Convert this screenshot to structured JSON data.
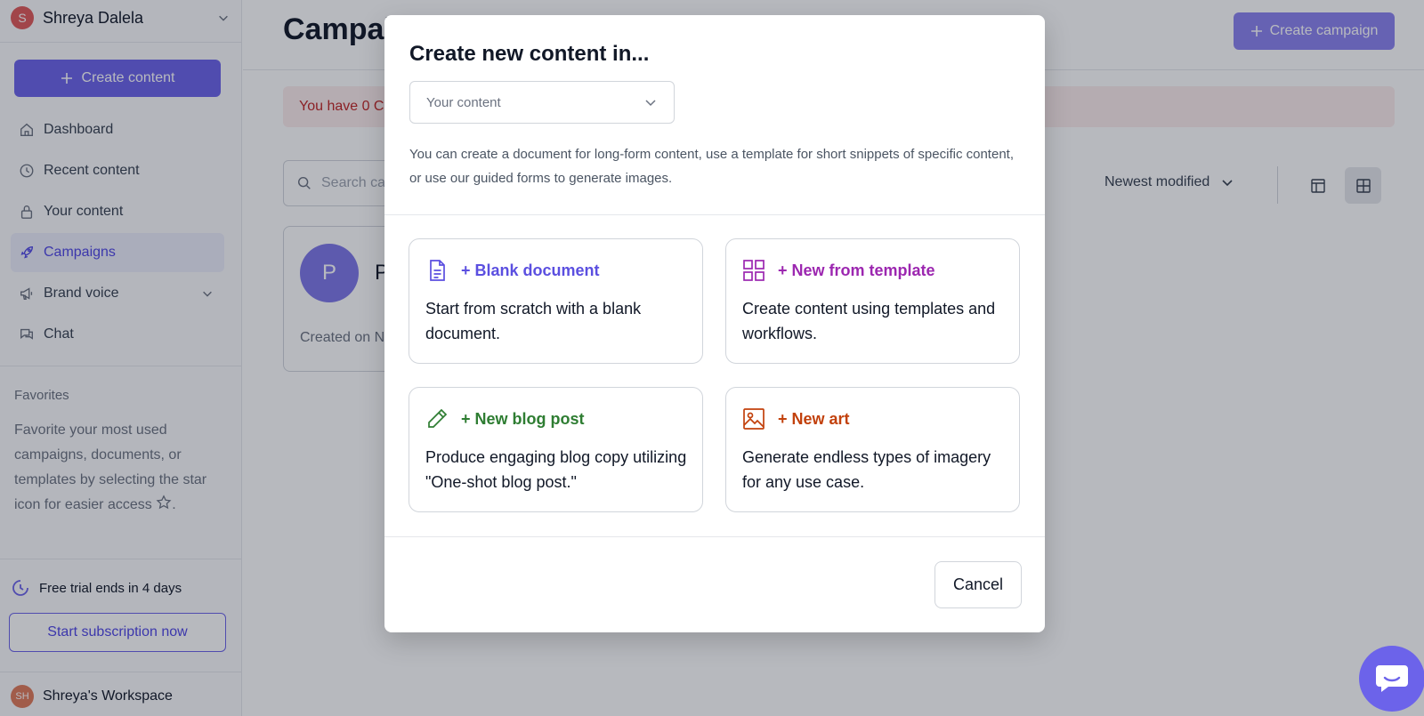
{
  "sidebar": {
    "user": {
      "initial": "S",
      "name": "Shreya Dalela"
    },
    "create_label": "Create content",
    "nav": [
      {
        "label": "Dashboard",
        "icon": "home-icon"
      },
      {
        "label": "Recent content",
        "icon": "clock-icon"
      },
      {
        "label": "Your content",
        "icon": "lock-icon"
      },
      {
        "label": "Campaigns",
        "icon": "rocket-icon",
        "active": true
      },
      {
        "label": "Brand voice",
        "icon": "megaphone-icon",
        "expandable": true
      },
      {
        "label": "Chat",
        "icon": "chat-icon"
      }
    ],
    "favorites": {
      "title": "Favorites",
      "text": "Favorite your most used campaigns, documents, or templates by selecting the star icon for easier access",
      "trail": "."
    },
    "trial_text": "Free trial ends in 4 days",
    "subscription_label": "Start subscription now",
    "workspace": {
      "initials": "SH",
      "name": "Shreya's Workspace"
    }
  },
  "main": {
    "title": "Campaigns",
    "create_campaign_label": "Create campaign",
    "alert_text": "You have 0 Campaigns remaining",
    "search_placeholder": "Search campaigns",
    "sort_label": "Newest modified",
    "card": {
      "initial": "P",
      "name": "P",
      "created": "Created on N"
    }
  },
  "modal": {
    "title": "Create new content in...",
    "dropdown_value": "Your content",
    "description": "You can create a document for long-form content, use a template for short snippets of specific content, or use our guided forms to generate images.",
    "options": [
      {
        "title": "+ Blank document",
        "desc": "Start from scratch with a blank document.",
        "color": "#5b4fe0",
        "icon": "document-icon"
      },
      {
        "title": "+ New from template",
        "desc": "Create content using templates and workflows.",
        "color": "#9c27b0",
        "icon": "grid-icon"
      },
      {
        "title": "+ New blog post",
        "desc": "Produce engaging blog copy utilizing \"One-shot blog post.\"",
        "color": "#2e7d32",
        "icon": "pencil-icon"
      },
      {
        "title": "+ New art",
        "desc": "Generate endless types of imagery for any use case.",
        "color": "#c2410c",
        "icon": "image-icon"
      }
    ],
    "cancel_label": "Cancel"
  },
  "colors": {
    "accent": "#6c63ea",
    "alert_bg": "#fdecec",
    "alert_text": "#c02626"
  }
}
